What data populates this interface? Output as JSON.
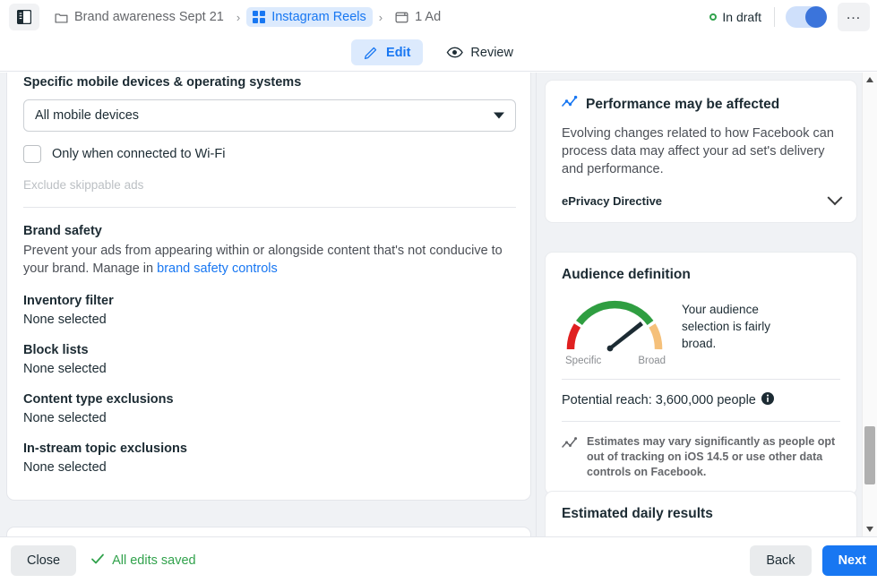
{
  "topbar": {
    "sidebar_toggle_icon": "sidebar-panel-icon",
    "breadcrumb": [
      {
        "icon": "folder-icon",
        "label": "Brand awareness Sept 21",
        "active": false
      },
      {
        "icon": "grid-squares-icon",
        "label": "Instagram Reels",
        "active": true
      },
      {
        "icon": "ad-card-icon",
        "label": "1 Ad",
        "active": false
      }
    ],
    "separator": "›",
    "status_label": "In draft",
    "status_color": "#31a24c",
    "toggle_on": true,
    "more_label": "…"
  },
  "tabs": [
    {
      "icon": "pencil-icon",
      "label": "Edit",
      "active": true
    },
    {
      "icon": "eye-icon",
      "label": "Review",
      "active": false
    }
  ],
  "main": {
    "devices_label": "Specific mobile devices & operating systems",
    "devices_value": "All mobile devices",
    "wifi_label": "Only when connected to Wi-Fi",
    "exclude_skippable": "Exclude skippable ads",
    "brand_safety_title": "Brand safety",
    "brand_safety_desc": "Prevent your ads from appearing within or alongside content that's not conducive to your brand. Manage in ",
    "brand_safety_link": "brand safety controls",
    "fields": [
      {
        "key": "Inventory filter",
        "value": "None selected"
      },
      {
        "key": "Block lists",
        "value": "None selected"
      },
      {
        "key": "Content type exclusions",
        "value": "None selected"
      },
      {
        "key": "In-stream topic exclusions",
        "value": "None selected"
      }
    ]
  },
  "sidepanel": {
    "performance": {
      "icon": "trend-chart-icon",
      "title": "Performance may be affected",
      "body": "Evolving changes related to how Facebook can process data may affect your ad set's delivery and performance.",
      "footer_label": "ePrivacy Directive",
      "footer_icon": "chevron-down-icon"
    },
    "audience": {
      "title": "Audience definition",
      "gauge_left_label": "Specific",
      "gauge_right_label": "Broad",
      "summary": "Your audience selection is fairly broad.",
      "reach_label": "Potential reach: 3,600,000 people",
      "info_icon": "info-icon",
      "estimate_note": "Estimates may vary significantly as people opt out of tracking on iOS 14.5 or use other data controls on Facebook.",
      "estimate_icon": "trend-chart-icon"
    },
    "estimated": {
      "title": "Estimated daily results"
    }
  },
  "chart_data": {
    "type": "gauge",
    "title": "Audience definition",
    "value_label": "fairly broad",
    "needle_angle_deg": 58,
    "range_labels": [
      "Specific",
      "Broad"
    ],
    "segments": [
      {
        "name": "Specific",
        "color": "#e02020",
        "span_deg": 22
      },
      {
        "name": "Middle",
        "color": "#2f9e41",
        "span_deg": 134
      },
      {
        "name": "Broad",
        "color": "#f5c07a",
        "span_deg": 24
      }
    ],
    "potential_reach": 3600000,
    "potential_reach_text": "Potential reach: 3,600,000 people"
  },
  "footer": {
    "close_label": "Close",
    "saved_label": "All edits saved",
    "saved_icon": "check-icon",
    "back_label": "Back",
    "next_label": "Next"
  }
}
